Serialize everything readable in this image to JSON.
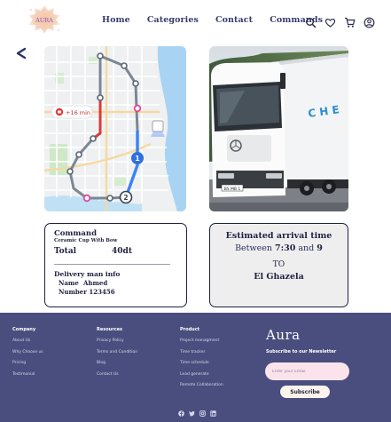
{
  "header": {
    "logo_text": "AURA",
    "nav": [
      "Home",
      "Categories",
      "Contact",
      "Commands"
    ],
    "icons": [
      "search-icon",
      "heart-icon",
      "cart-icon",
      "user-icon"
    ]
  },
  "back_icon": "chevron-left-icon",
  "map": {
    "route_badge": "+16 min",
    "markers": [
      "1",
      "2"
    ]
  },
  "command": {
    "title": "Command",
    "product": "Ceramic Cup With Bow",
    "total_label": "Total",
    "total_value": "40dt",
    "delivery_title": "Delivery man info",
    "name_label": "Name",
    "name_value": "Ahmed",
    "number_label": "Number 123456"
  },
  "eta": {
    "title": "Estimated arrival time",
    "between": "Between",
    "from": "7:30",
    "and": "and",
    "to_time": "9",
    "to_label": "TO",
    "destination": "El Ghazela"
  },
  "footer": {
    "columns": [
      {
        "title": "Company",
        "links": [
          "About Us",
          "Why Choose us",
          "Pricing",
          "Testimonial"
        ]
      },
      {
        "title": "Resources",
        "links": [
          "Privacy Policy",
          "Terms and Condition",
          "Blog",
          "Contact Us"
        ]
      },
      {
        "title": "Product",
        "links": [
          "Project managment",
          "Time tracker",
          "Time schedule",
          "Lead generate",
          "Remote Collaboration"
        ]
      }
    ],
    "brand": "Aura",
    "newsletter_title": "Subscribe to our Newsletter",
    "email_placeholder": "Enter your Email",
    "subscribe_label": "Subscribe",
    "social_icons": [
      "facebook-icon",
      "twitter-icon",
      "instagram-icon",
      "linkedin-icon"
    ]
  },
  "colors": {
    "footer_bg": "#4a4e7e",
    "nav_text": "#363b6e",
    "route_blue": "#3b82f6",
    "route_red": "#d93a3a"
  }
}
